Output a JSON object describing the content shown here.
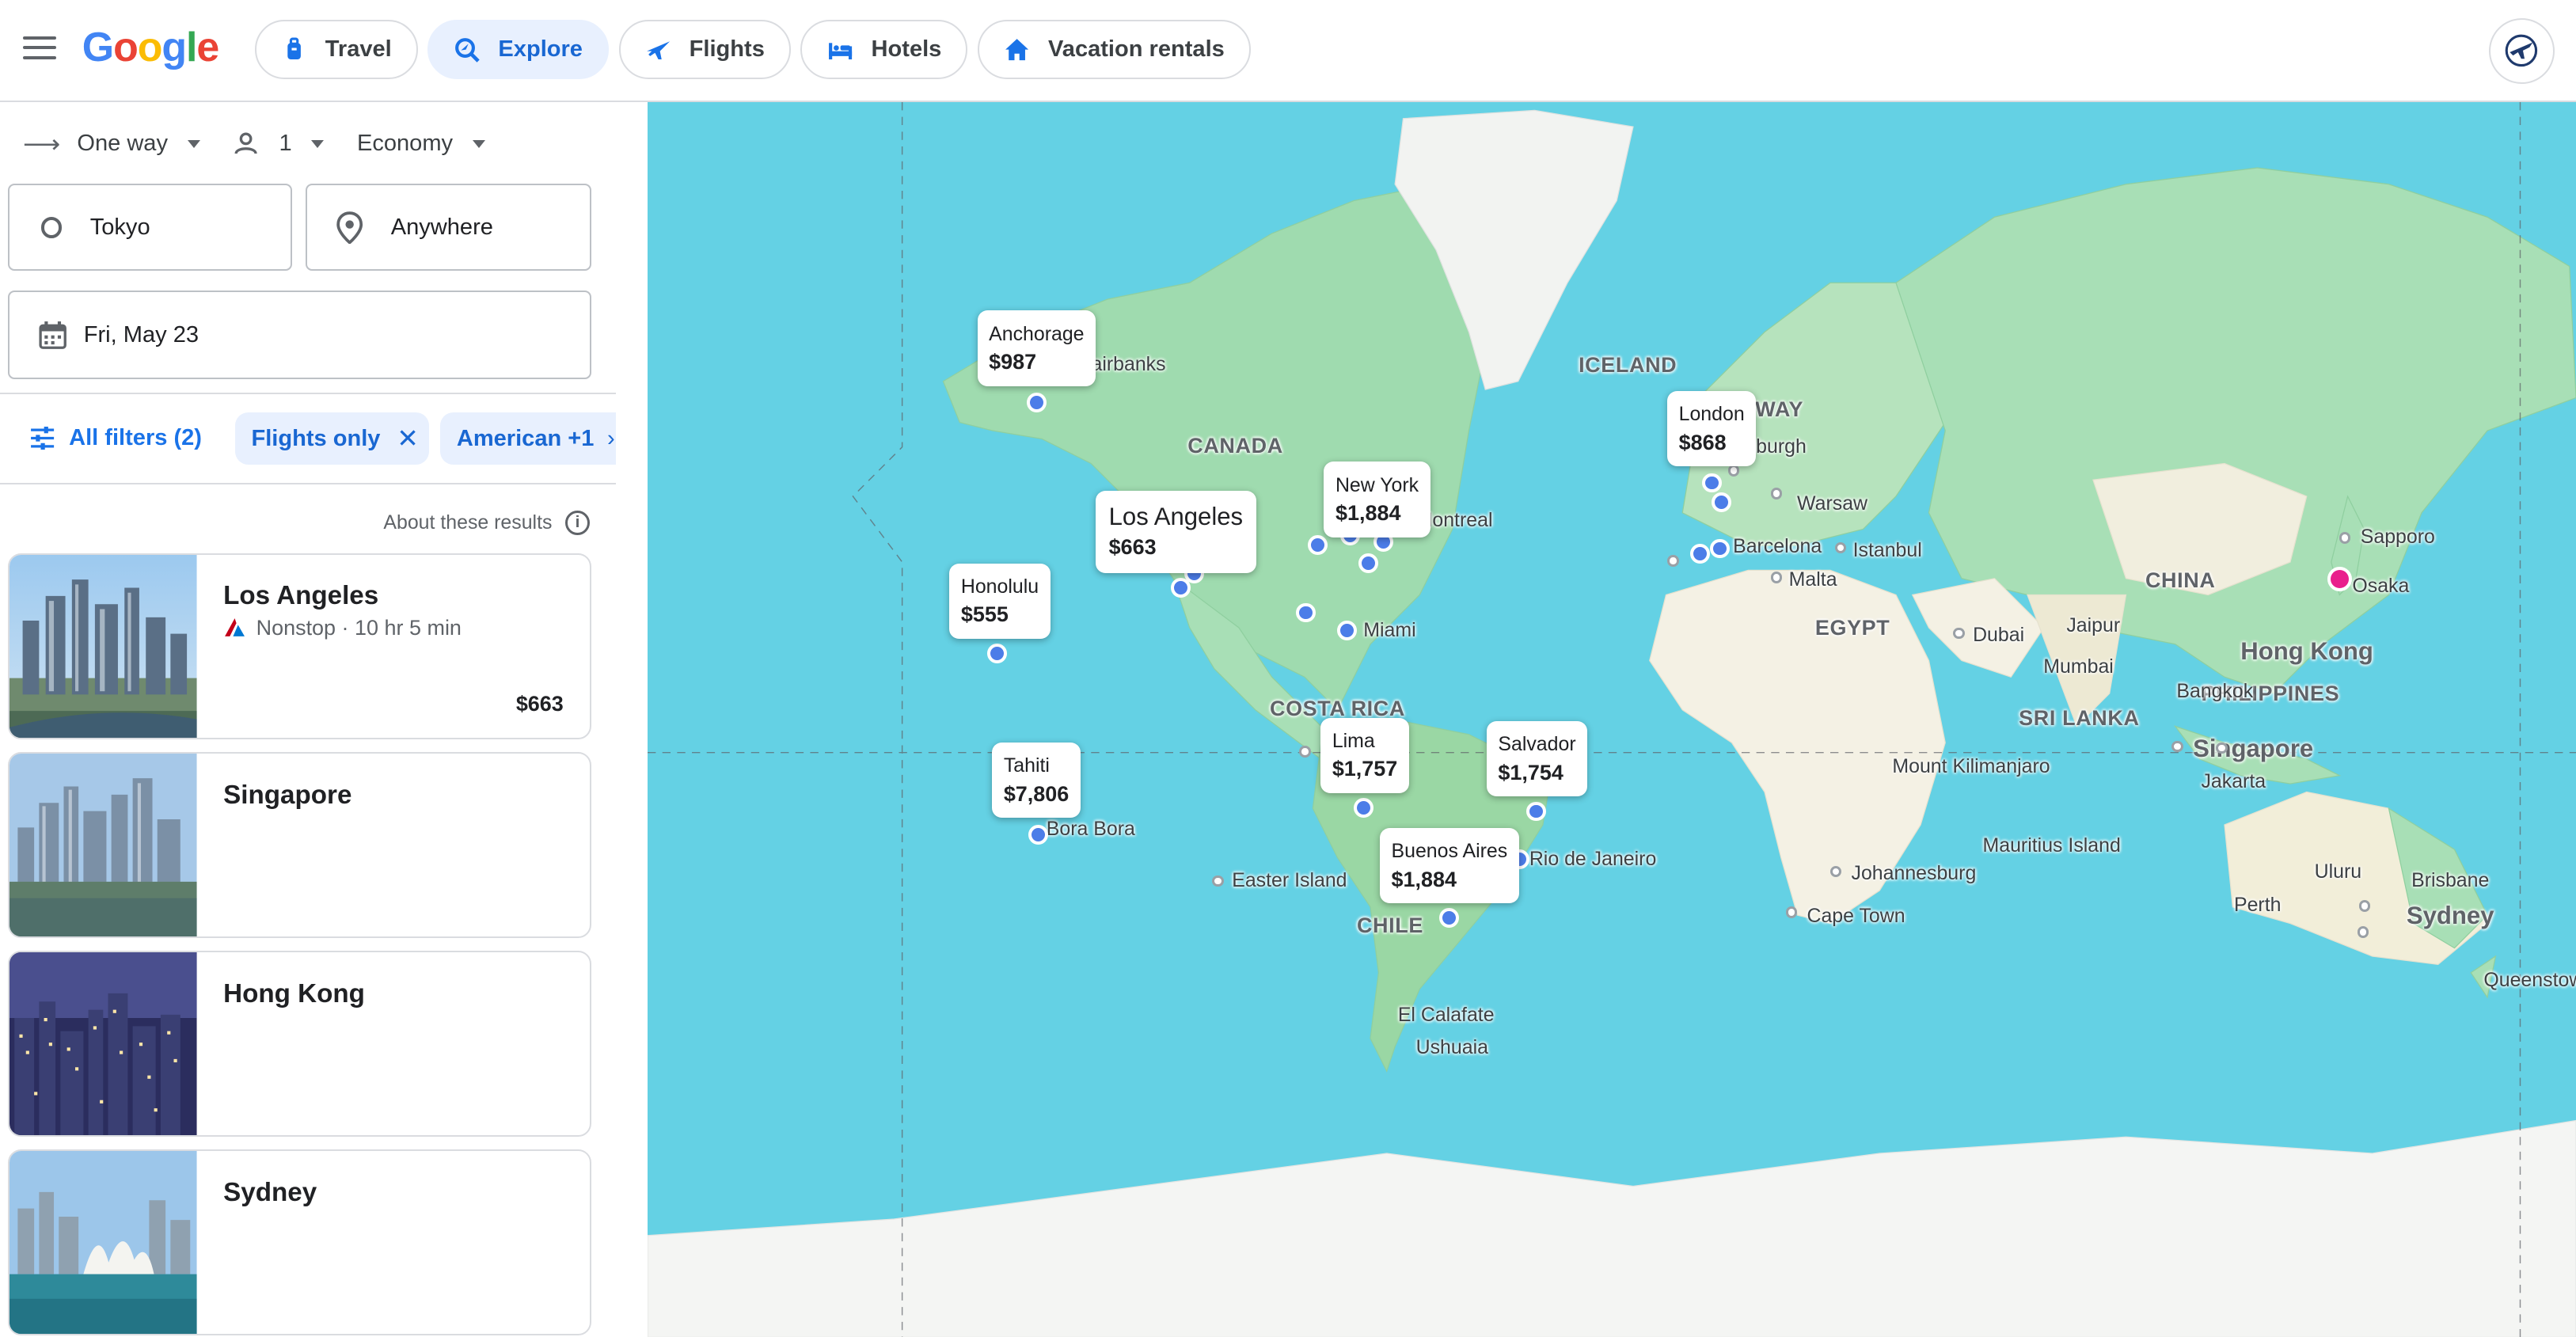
{
  "brand": {
    "logo": "Google"
  },
  "nav": {
    "tabs": [
      {
        "label": "Travel"
      },
      {
        "label": "Explore"
      },
      {
        "label": "Flights"
      },
      {
        "label": "Hotels"
      },
      {
        "label": "Vacation rentals"
      }
    ]
  },
  "search": {
    "trip_type": "One way",
    "passengers": "1",
    "cabin": "Economy",
    "origin": "Tokyo",
    "destination": "Anywhere",
    "date": "Fri, May 23"
  },
  "filters": {
    "all_filters": "All filters (2)",
    "chips": [
      "Flights only",
      "American +1"
    ]
  },
  "about_results": "About these results",
  "results": [
    {
      "city": "Los Angeles",
      "detail": "Nonstop · 10 hr 5 min",
      "price": "$663"
    },
    {
      "city": "Singapore"
    },
    {
      "city": "Hong Kong"
    },
    {
      "city": "Sydney"
    }
  ],
  "map": {
    "callouts": [
      {
        "city": "Anchorage",
        "price": "$987"
      },
      {
        "city": "Los Angeles",
        "price": "$663"
      },
      {
        "city": "Honolulu",
        "price": "$555"
      },
      {
        "city": "New York",
        "price": "$1,884"
      },
      {
        "city": "London",
        "price": "$868"
      },
      {
        "city": "Tahiti",
        "price": "$7,806"
      },
      {
        "city": "Lima",
        "price": "$1,757"
      },
      {
        "city": "Salvador",
        "price": "$1,754"
      },
      {
        "city": "Buenos Aires",
        "price": "$1,884"
      }
    ],
    "country_labels": [
      "CANADA",
      "ICELAND",
      "NORWAY",
      "EGYPT",
      "CHINA",
      "SRI LANKA",
      "PHILIPPINES",
      "COSTA RICA",
      "CHILE"
    ],
    "place_labels": [
      "Fairbanks",
      "Montreal",
      "Miami",
      "Edinburgh",
      "Warsaw",
      "Barcelona",
      "Istanbul",
      "Malta",
      "Dubai",
      "Jaipur",
      "Mumbai",
      "Bangkok",
      "Jakarta",
      "Sapporo",
      "Osaka",
      "Mount Kilimanjaro",
      "Johannesburg",
      "Cape Town",
      "Mauritius Island",
      "Rio de Janeiro",
      "Easter Island",
      "Bora Bora",
      "El Calafate",
      "Ushuaia",
      "Uluru",
      "Perth",
      "Brisbane",
      "Queenstown"
    ],
    "major_labels": [
      "Hong Kong",
      "Singapore",
      "Sydney"
    ],
    "home_color": "#e91e8c",
    "pin_color": "#4c7de8",
    "water_color": "#64d1e4"
  }
}
